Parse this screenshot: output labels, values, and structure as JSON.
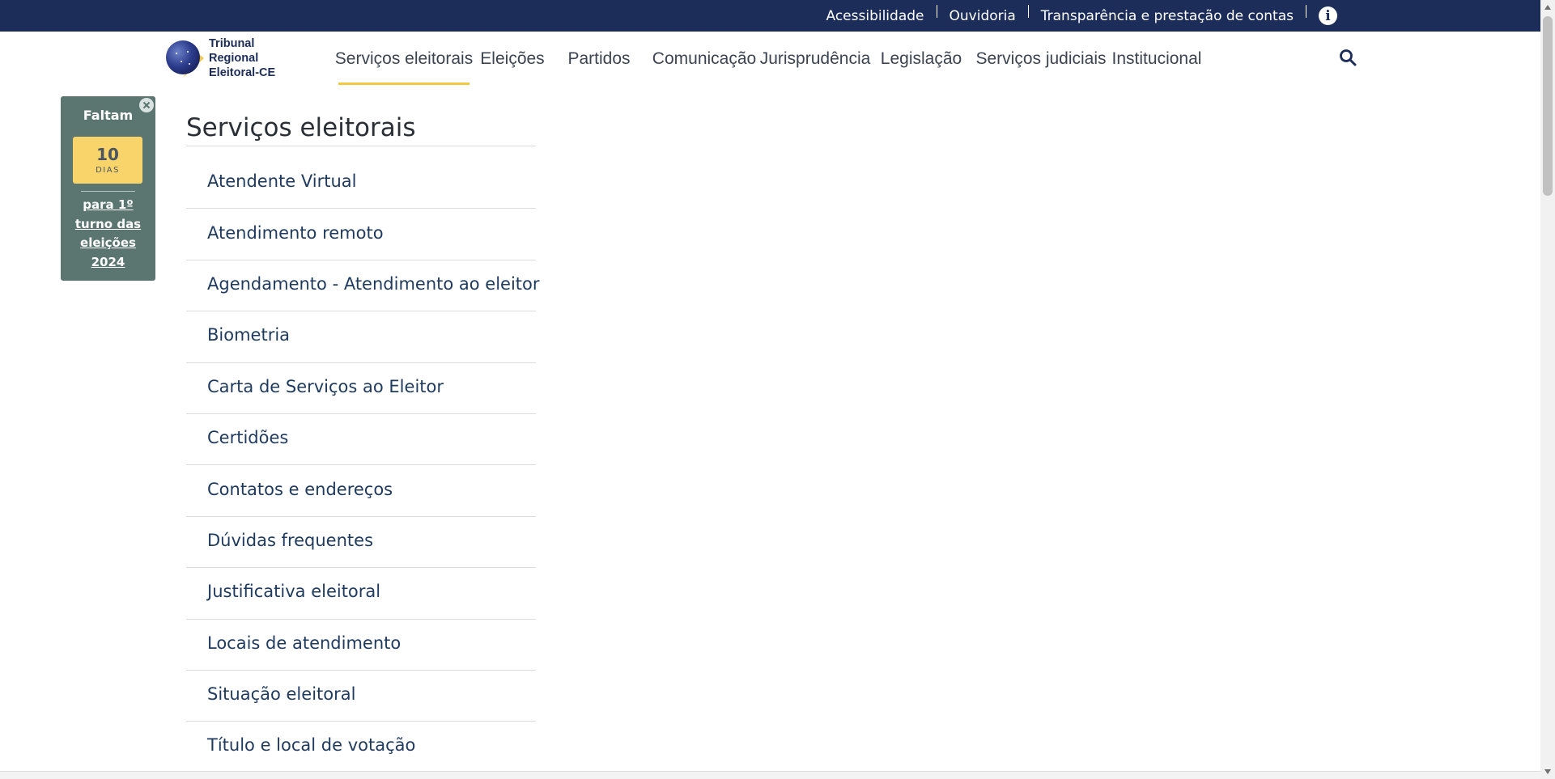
{
  "topbar": {
    "links": [
      "Acessibilidade",
      "Ouvidoria",
      "Transparência e prestação de contas"
    ],
    "info_icon": "info-icon"
  },
  "logo": {
    "lines": [
      "Tribunal",
      "Regional",
      "Eleitoral-CE"
    ]
  },
  "nav": {
    "items": [
      {
        "label": "Serviços eleitorais",
        "active": true
      },
      {
        "label": "Eleições",
        "active": false
      },
      {
        "label": "Partidos",
        "active": false
      },
      {
        "label": "Comunicação",
        "active": false
      },
      {
        "label": "Jurisprudência",
        "active": false
      },
      {
        "label": "Legislação",
        "active": false
      },
      {
        "label": "Serviços judiciais",
        "active": false
      },
      {
        "label": "Institucional",
        "active": false
      }
    ],
    "search_icon": "search-icon"
  },
  "countdown": {
    "title": "Faltam",
    "number": "10",
    "unit": "DIAS",
    "link_lines": [
      "para 1º",
      "turno das",
      "eleições",
      "2024"
    ]
  },
  "section": {
    "title": "Serviços eleitorais",
    "items": [
      "Atendente Virtual",
      "Atendimento remoto",
      "Agendamento - Atendimento ao eleitor",
      "Biometria",
      "Carta de Serviços ao Eleitor",
      "Certidões",
      "Contatos e endereços",
      "Dúvidas frequentes",
      "Justificativa eleitoral",
      "Locais de atendimento",
      "Situação eleitoral",
      "Título e local de votação"
    ]
  },
  "colors": {
    "topbar": "#1c2d5a",
    "accent_underline": "#f5c842",
    "countdown_bg": "#5b7570",
    "countdown_box": "#f8d46b",
    "link_text": "#1f3a5f"
  }
}
